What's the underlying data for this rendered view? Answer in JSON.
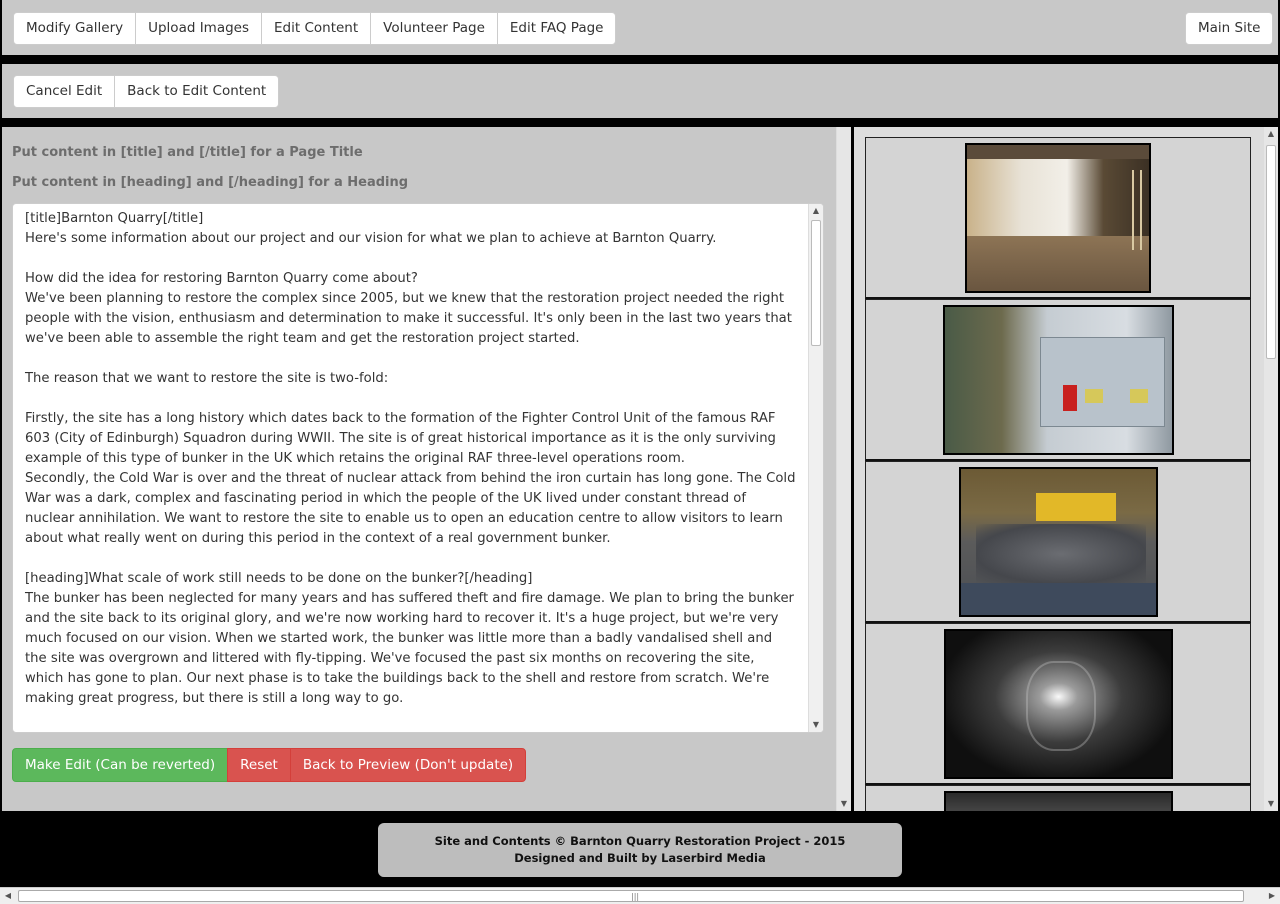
{
  "top_nav": {
    "items": [
      "Modify Gallery",
      "Upload Images",
      "Edit Content",
      "Volunteer Page",
      "Edit FAQ Page"
    ],
    "main_site": "Main Site"
  },
  "edit_bar": {
    "cancel": "Cancel Edit",
    "back": "Back to Edit Content"
  },
  "hints": {
    "title": "Put content in [title] and [/title] for a Page Title",
    "heading": "Put content in [heading] and [/heading] for a Heading"
  },
  "editor": {
    "content": "[title]Barnton Quarry[/title]\nHere's some information about our project and our vision for what we plan to achieve at Barnton Quarry.\n\nHow did the idea for restoring Barnton Quarry come about?\nWe've been planning to restore the complex since 2005, but we knew that the restoration project needed the right people with the vision, enthusiasm and determination to make it successful. It's only been in the last two years that we've been able to assemble the right team and get the restoration project started.\n\nThe reason that we want to restore the site is two-fold:\n\nFirstly, the site has a long history which dates back to the formation of the Fighter Control Unit of the famous RAF 603 (City of Edinburgh) Squadron during WWII. The site is of great historical importance as it is the only surviving example of this type of bunker in the UK which retains the original RAF three-level operations room.\nSecondly, the Cold War is over and the threat of nuclear attack from behind the iron curtain has long gone. The Cold War was a dark, complex and fascinating period in which the people of the UK lived under constant thread of nuclear annihilation. We want to restore the site to enable us to open an education centre to allow visitors to learn about what really went on during this period in the context of a real government bunker.\n\n[heading]What scale of work still needs to be done on the bunker?[/heading]\nThe bunker has been neglected for many years and has suffered theft and fire damage. We plan to bring the bunker and the site back to its original glory, and we're now working hard to recover it. It's a huge project, but we're very much focused on our vision. When we started work, the bunker was little more than a badly vandalised shell and the site was overgrown and littered with fly-tipping. We've focused the past six months on recovering the site, which has gone to plan. Our next phase is to take the buildings back to the shell and restore from scratch. We're making great progress, but there is still a long way to go."
  },
  "actions": {
    "make_edit": "Make Edit (Can be reverted)",
    "reset": "Reset",
    "back_preview": "Back to Preview (Don't update)"
  },
  "gallery": {
    "images": [
      {
        "icon": "photo-room-renovation"
      },
      {
        "icon": "photo-electrical-cabinets"
      },
      {
        "icon": "photo-rubble-skip"
      },
      {
        "icon": "photo-tunnel-bw"
      },
      {
        "icon": "photo-corridor-partial"
      }
    ]
  },
  "footer": {
    "line1": "Site and Contents © Barnton Quarry Restoration Project - 2015",
    "line2": "Designed and Built by Laserbird Media"
  },
  "colors": {
    "panel": "#c8c8c8",
    "success": "#5cb85c",
    "danger": "#d9534f"
  }
}
